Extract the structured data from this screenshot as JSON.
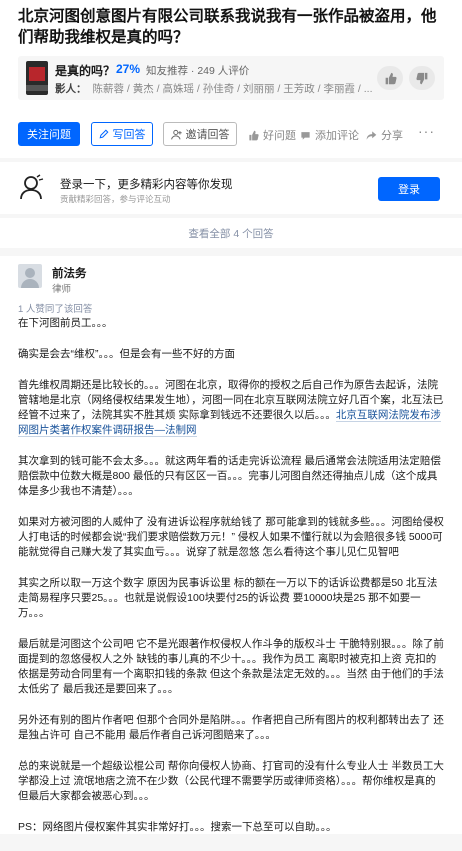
{
  "question": {
    "title": "北京河图创意图片有限公司联系我说我有一张作品被盗用，他们帮助我维权是真的吗？"
  },
  "truth_panel": {
    "label": "是真的吗？",
    "percent": "27%",
    "meta": "知友推荐 · 249 人评价",
    "people_label": "影人：",
    "people": "陈薪蓉 / 黄杰 / 高姝瑶 / 孙佳奇 / 刘丽丽 / 王芳政 / 李丽霞 / ..."
  },
  "actions": {
    "follow": "关注问题",
    "write": "写回答",
    "invite": "邀请回答",
    "good_question": "好问题",
    "add_comment": "添加评论",
    "share": "分享"
  },
  "login_prompt": {
    "title": "登录一下，更多精彩内容等你发现",
    "subtitle": "贡献精彩回答，参与评论互动",
    "button": "登录"
  },
  "see_all": "查看全部 4 个回答",
  "answer": {
    "author": "前法务",
    "role": "律师",
    "agree": "1 人赞同了该回答",
    "paragraphs": [
      "在下河图前员工。。。",
      "确实是会去“维权”。。。但是会有一些不好的方面",
      "首先维权周期还是比较长的。。。河图在北京，取得你的授权之后自己作为原告去起诉，法院管辖地是北京（网络侵权结果发生地），河图一同在北京互联网法院立好几百个案，北互法已经管不过来了，法院其实不胜其烦 实际拿到钱远不还要很久以后。。。",
      "其次拿到的钱可能不会太多。。。就这两年看的话走完诉讼流程 最后通常会法院适用法定赔偿 赔偿款中位数大概是800 最低的只有区区一百。。。完事儿河图自然还得抽点儿成（这个成具体是多少我也不清楚）。。。",
      "如果对方被河图的人威仲了 没有进诉讼程序就给钱了 那可能拿到的钱就多些。。。河图给侵权人打电话的时候都会说“我们要求赔偿数万元！” 侵权人如果不懂行就以为会赔很多钱 5000可能就觉得自己赚大发了其实血亏。。。说穿了就是忽悠 怎么看待这个事儿见仁见智吧",
      "其实之所以取一万这个数字 原因为民事诉讼里 标的额在一万以下的话诉讼费都是50 北互法走简易程序只要25。。。也就是说假设100块要付25的诉讼费 要10000块是25 那不如要一万。。。",
      "最后就是河图这个公司吧 它不是光跟著作权侵权人作斗争的版权斗士 干脆特别狠。。。除了前面提到的忽悠侵权人之外 缺钱的事儿真的不少十。。。我作为员工 离职时被克扣上资 克扣的依据是劳动合同里有一个离职扣钱的条款 但这个条款是法定无效的。。。当然 由于他们的手法太低劣了 最后我还是要回来了。。。",
      "另外还有别的图片作者吧 但那个合同外是陷阱。。。作者把自己所有图片的权利都转出去了 还是独占许可 自己不能用 最后作者自己诉河图赔来了。。。",
      "总的来说就是一个超级讼棍公司 帮你向侵权人协商、打官司的没有什么专业人士 半数员工大学都没上过 流氓地痞之流不在少数（公民代理不需要学历或律师资格）。。。帮你维权是真的 但最后大家都会被恶心到。。。",
      "PS：网络图片侵权案件其实非常好打。。。搜索一下总至可以自助。。。"
    ],
    "link_text": "北京互联网法院发布涉网图片类著作权案件调研报告—法制网"
  }
}
